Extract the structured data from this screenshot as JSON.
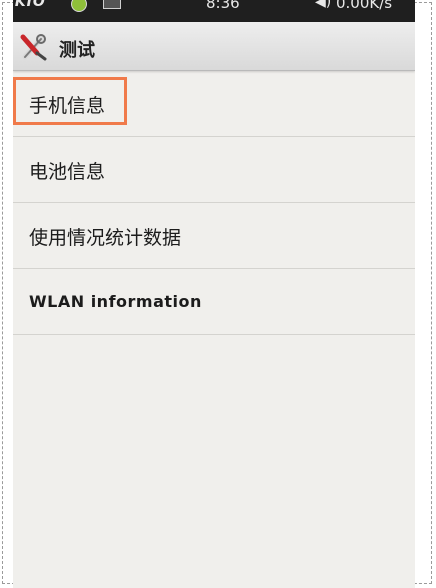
{
  "status_bar": {
    "carrier": "VKIO",
    "time": "8:36",
    "speed": "0.00K/s"
  },
  "action_bar": {
    "title": "测试",
    "app_icon": "tools-icon"
  },
  "list": {
    "items": [
      {
        "label": "手机信息"
      },
      {
        "label": "电池信息"
      },
      {
        "label": "使用情况统计数据"
      },
      {
        "label": "WLAN information"
      }
    ]
  },
  "colors": {
    "highlight": "#f07a4a",
    "background": "#f0efec",
    "status_bar": "#1f1f1f"
  }
}
